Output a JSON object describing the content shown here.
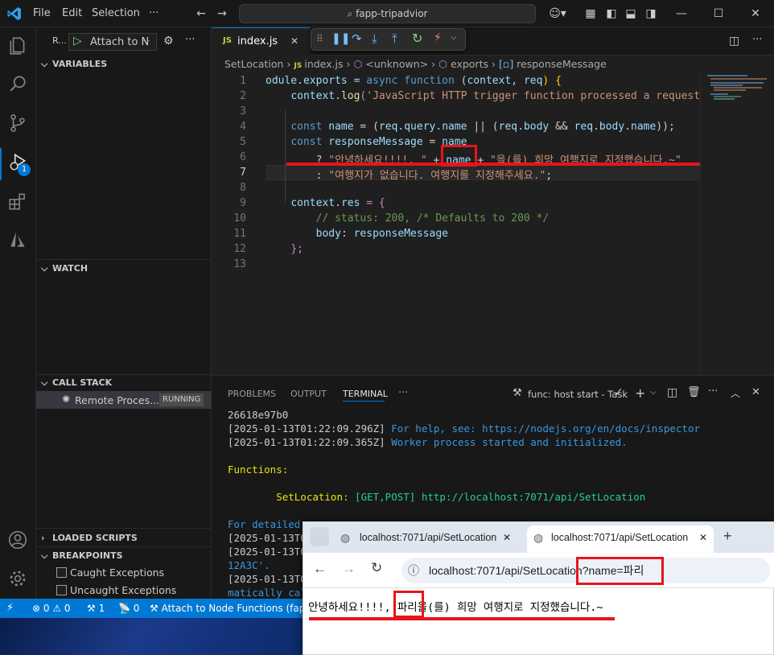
{
  "titlebar": {
    "menus": [
      "File",
      "Edit",
      "Selection",
      "···"
    ],
    "search": "fapp-tripadvior"
  },
  "activity": {
    "debug_badge": "1"
  },
  "sidebar": {
    "run_label": "R...",
    "config": "Attach to N",
    "variables": "VARIABLES",
    "watch": "WATCH",
    "call_stack": "CALL STACK",
    "process": "Remote Proces...",
    "process_status": "RUNNING",
    "loaded_scripts": "LOADED SCRIPTS",
    "breakpoints": "BREAKPOINTS",
    "bp_items": [
      "Caught Exceptions",
      "Uncaught Exceptions"
    ]
  },
  "editor": {
    "tab": "index.js",
    "breadcrumbs": [
      "SetLocation",
      "index.js",
      "<unknown>",
      "exports",
      "responseMessage"
    ]
  },
  "code": {
    "l1a": "odule.exports = ",
    "l1b": "async",
    "l1c": " ",
    "l1d": "function",
    "l1e": " (",
    "l1f": "context",
    "l1g": ", ",
    "l1h": "req",
    "l1i": ") {",
    "l2a": "    ",
    "l2b": "context",
    "l2c": ".",
    "l2d": "log",
    "l2e": "(",
    "l2f": "'JavaScript HTTP trigger function processed a request.'",
    "l2g": ");",
    "l4a": "    ",
    "l4b": "const",
    "l4c": " ",
    "l4d": "name",
    "l4e": " = (",
    "l4f": "req",
    "l4g": ".",
    "l4h": "query",
    "l4i": ".",
    "l4j": "name",
    "l4k": " || (",
    "l4l": "req",
    "l4m": ".",
    "l4n": "body",
    "l4o": " && ",
    "l4p": "req",
    "l4q": ".",
    "l4r": "body",
    "l4s": ".",
    "l4t": "name",
    "l4u": "));",
    "l5a": "    ",
    "l5b": "const",
    "l5c": " ",
    "l5d": "responseMessage",
    "l5e": " = ",
    "l5f": "name",
    "l6a": "        ? ",
    "l6b": "\"안녕하세요!!!!, \"",
    "l6c": " + ",
    "l6d": "name",
    "l6e": " + ",
    "l6f": "\"을(를) 희망 여행지로 지정했습니다.~\"",
    "l7a": "        : ",
    "l7b": "\"여행지가 없습니다. 여행지를 지정해주세요.\"",
    "l7c": ";",
    "l9a": "    ",
    "l9b": "context",
    "l9c": ".",
    "l9d": "res",
    "l9e": " = {",
    "l10a": "        ",
    "l10b": "// status: 200, /* Defaults to 200 */",
    "l11a": "        ",
    "l11b": "body",
    "l11c": ": ",
    "l11d": "responseMessage",
    "l12a": "    ",
    "l12b": "};"
  },
  "panel": {
    "tabs": [
      "PROBLEMS",
      "OUTPUT",
      "TERMINAL",
      "···"
    ],
    "task": "func: host start - Task",
    "lines": {
      "t1": "26618e97b0",
      "t2a": "[2025-01-13T01:22:09.296Z] ",
      "t2b": "For help, see: https://nodejs.org/en/docs/inspector",
      "t3a": "[2025-01-13T01:22:09.365Z] ",
      "t3b": "Worker process started and initialized.",
      "t5": "Functions:",
      "t7a": "        SetLocation: ",
      "t7b": "[GET,POST] http://localhost:7071/api/SetLocation",
      "t9": "For detailed",
      "t10": "[2025-01-13T0",
      "t11": "[2025-01-13T0",
      "t12": "12A3C'.",
      "t13": "[2025-01-13T0",
      "t14": "matically cal"
    }
  },
  "statusbar": {
    "errors": "0",
    "warnings": "0",
    "ports": "1",
    "radio": "0",
    "debug": "Attach to Node Functions (fapp-"
  },
  "browser": {
    "tab1": "localhost:7071/api/SetLocation",
    "tab2": "localhost:7071/api/SetLocation",
    "url_base": "localhost:7071/api/SetLocation",
    "url_query": "?name=파리",
    "content_a": "안녕하세요!!!!, ",
    "content_b": "파리",
    "content_c": "을(를) 희망 여행지로 지정했습니다.~"
  }
}
